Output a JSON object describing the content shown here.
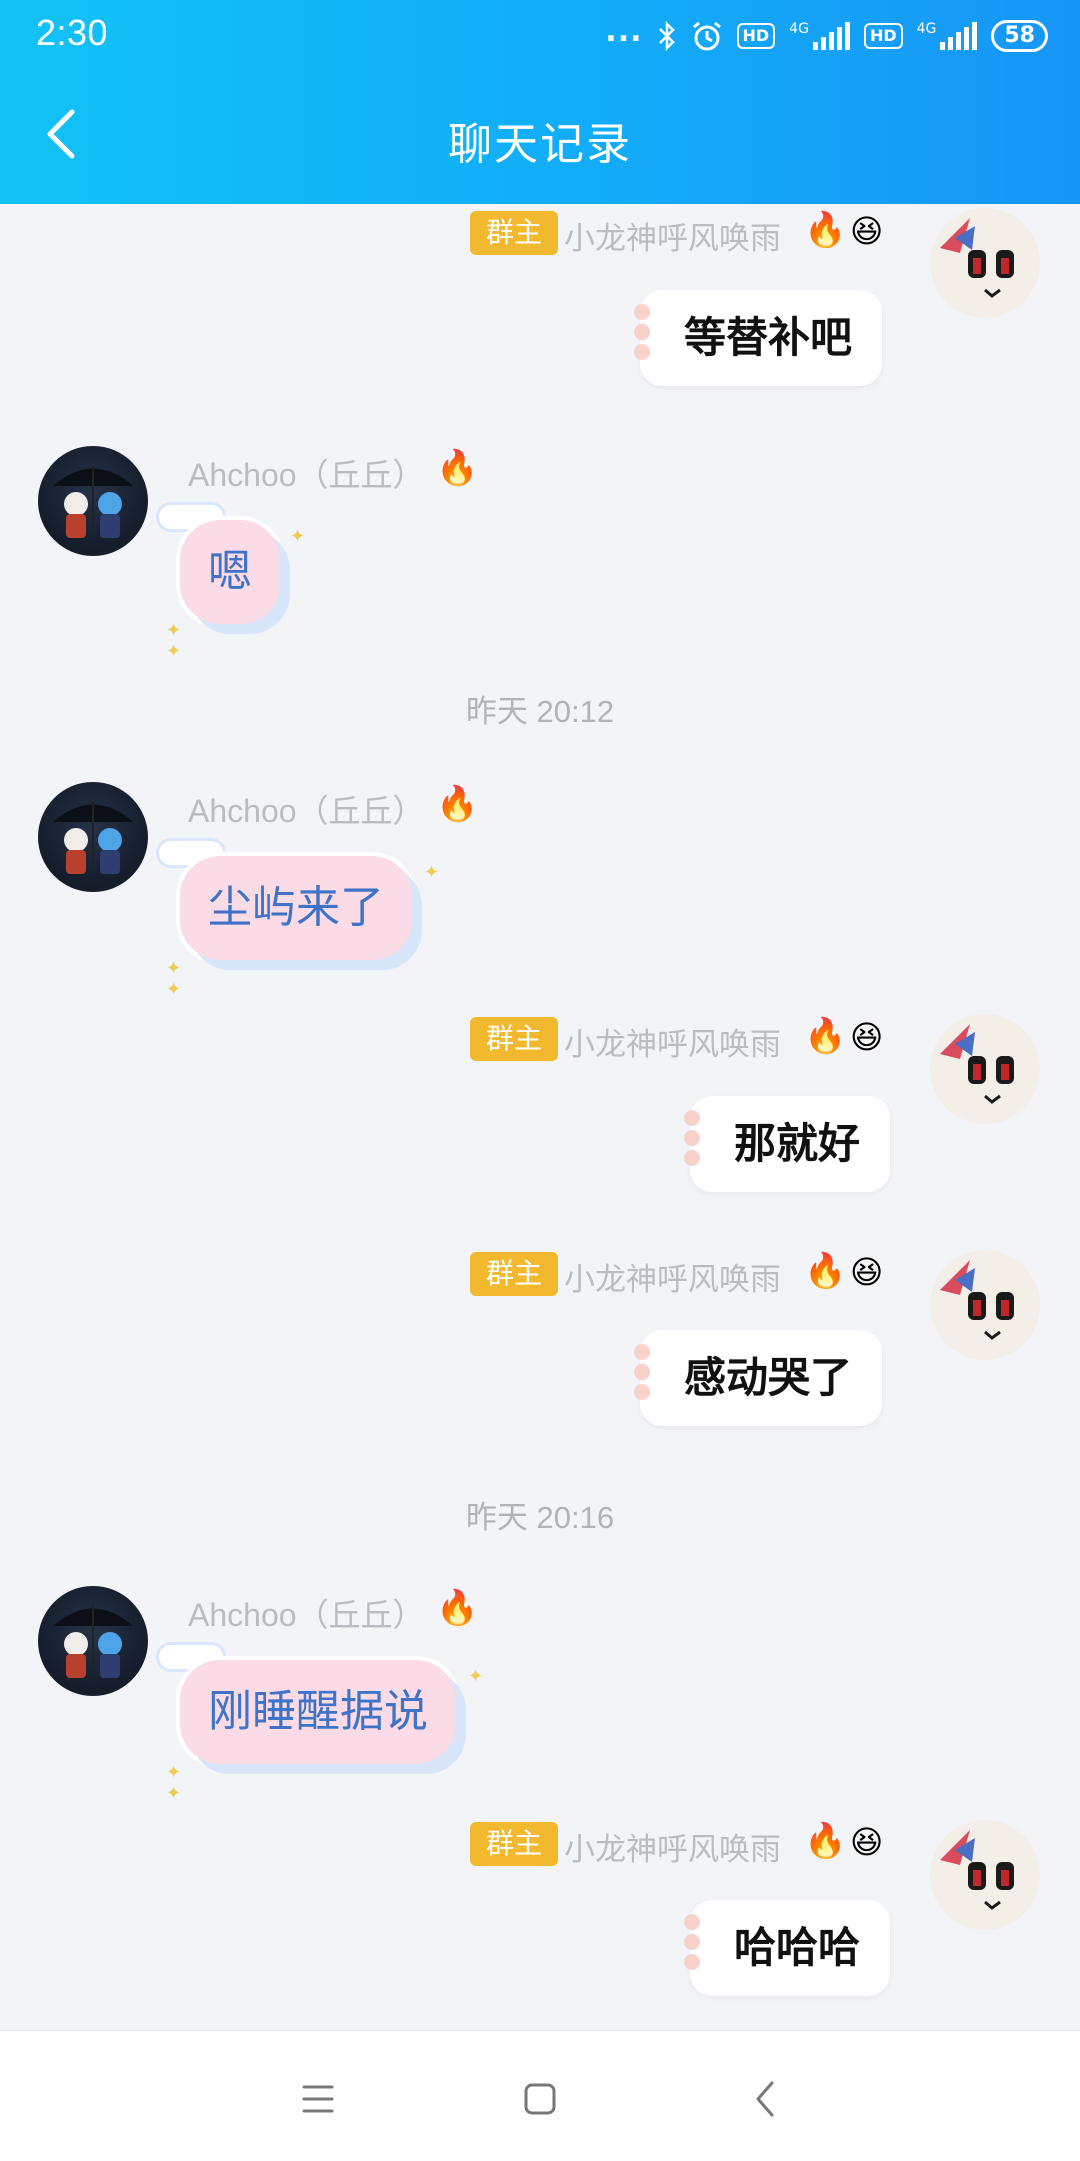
{
  "status_bar": {
    "time": "2:30",
    "dots": "...",
    "hd1": "HD",
    "hd2": "HD",
    "net1": "4G",
    "net2": "4G",
    "battery": "58"
  },
  "header": {
    "title": "聊天记录"
  },
  "messages": [
    {
      "side": "right",
      "badge": "群主",
      "name": "小龙神呼风唤雨",
      "text": "等替补吧"
    },
    {
      "side": "left",
      "name": "Ahchoo（丘丘）",
      "text": "嗯"
    },
    {
      "timestamp": "昨天 20:12"
    },
    {
      "side": "left",
      "name": "Ahchoo（丘丘）",
      "text": "尘屿来了"
    },
    {
      "side": "right",
      "badge": "群主",
      "name": "小龙神呼风唤雨",
      "text": "那就好"
    },
    {
      "side": "right",
      "badge": "群主",
      "name": "小龙神呼风唤雨",
      "text": "感动哭了"
    },
    {
      "timestamp": "昨天 20:16"
    },
    {
      "side": "left",
      "name": "Ahchoo（丘丘）",
      "text": "刚睡醒据说"
    },
    {
      "side": "right",
      "badge": "群主",
      "name": "小龙神呼风唤雨",
      "text": "哈哈哈"
    }
  ],
  "icons": {
    "fire": "🔥",
    "smiley": "😆",
    "back": "chevron-left-icon"
  },
  "colors": {
    "header_start": "#12c2f5",
    "header_end": "#1796f6",
    "badge": "#f2b92f",
    "left_text": "#3e73c8",
    "left_bubble": "#fbdbe6"
  }
}
